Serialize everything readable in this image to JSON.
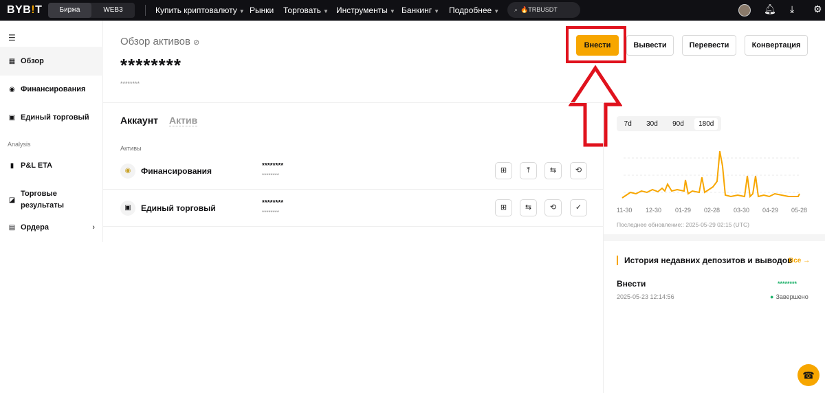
{
  "topbar": {
    "logo_main": "BYB",
    "logo_bar": "!",
    "logo_end": "T",
    "seg": [
      "Биржа",
      "WEB3"
    ],
    "nav": [
      "Купить криптовалюту",
      "Рынки",
      "Торговать",
      "Инструменты",
      "Банкинг",
      "Подробнее"
    ],
    "search_text": "TRBUSDT"
  },
  "sidebar": {
    "items": [
      {
        "label": "Обзор",
        "icon": "grid-icon"
      },
      {
        "label": "Финансирования",
        "icon": "coin-icon"
      },
      {
        "label": "Единый торговый",
        "icon": "wallet-icon"
      },
      {
        "label": "P&L ETA",
        "icon": "bar-chart-icon"
      },
      {
        "label": "Торговые результаты",
        "icon": "chart-box-icon"
      },
      {
        "label": "Ордера",
        "icon": "document-icon"
      }
    ],
    "section_label": "Analysis"
  },
  "overview": {
    "title": "Обзор активов",
    "balance_main": "********",
    "balance_sub": "********"
  },
  "actions": {
    "deposit": "Внести",
    "withdraw": "Вывести",
    "transfer": "Перевести",
    "convert": "Конвертация"
  },
  "tabs": [
    "Аккаунт",
    "Актив"
  ],
  "assets_label": "Активы",
  "accounts": [
    {
      "name": "Финансирования",
      "value": "********",
      "sub": "********"
    },
    {
      "name": "Единый торговый",
      "value": "********",
      "sub": "********"
    }
  ],
  "chart": {
    "periods": [
      "7d",
      "30d",
      "90d",
      "180d"
    ],
    "selected_period": "180d",
    "x_ticks": [
      "11-30",
      "12-30",
      "01-29",
      "02-28",
      "03-30",
      "04-29",
      "05-28"
    ],
    "updated": "Последнее обновление:: 2025-05-29 02:15 (UTC)",
    "line_color": "#f7a600"
  },
  "chart_data": {
    "type": "line",
    "x": [
      "11-30",
      "12-30",
      "01-29",
      "02-28",
      "03-30",
      "04-29",
      "05-28"
    ],
    "title": "",
    "xlabel": "",
    "ylabel": "",
    "series": [
      {
        "values": [
          1,
          2,
          3,
          9,
          2,
          5,
          1
        ]
      }
    ]
  },
  "history": {
    "title": "История недавних депозитов и выводов",
    "all": "Все",
    "item": {
      "type": "Внести",
      "amount": "********",
      "date": "2025-05-23 12:14:56",
      "status": "Завершено"
    }
  }
}
